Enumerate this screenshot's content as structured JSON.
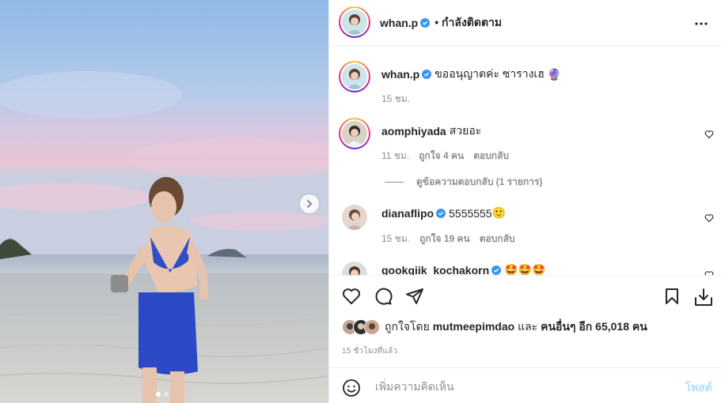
{
  "post": {
    "author": "whan.p",
    "header_status": "• กำลังติดตาม",
    "caption": "ขออนุญาตค่ะ ซารางเฮ",
    "caption_emoji": "🔮",
    "caption_time": "15 ชม."
  },
  "comments": [
    {
      "user": "aomphiyada",
      "text": "สวยอะ",
      "time": "11 ชม.",
      "likes": "ถูกใจ 4 คน",
      "reply": "ตอบกลับ",
      "view_replies": "ดูข้อความตอบกลับ (1 รายการ)"
    },
    {
      "user": "dianaflipo",
      "text": "5555555",
      "emoji": "🙂",
      "time": "15 ชม.",
      "likes": "ถูกใจ 19 คน",
      "reply": "ตอบกลับ"
    },
    {
      "user": "gookgiik_kochakorn",
      "text": "",
      "emoji": "🤩🤩🤩"
    }
  ],
  "likes": {
    "prefix": "ถูกใจโดย",
    "first_user": "mutmeepimdao",
    "and": "และ",
    "others": "คนอื่นๆ อีก 65,018 คน"
  },
  "post_time": "15 ชั่วโมงที่แล้ว",
  "add_comment": {
    "placeholder": "เพิ่มความคิดเห็น",
    "post_label": "โพสต์"
  },
  "colors": {
    "verified": "#3897f0",
    "post_disabled": "#b2dffc"
  },
  "icons": [
    "more-icon",
    "heart-icon",
    "comment-icon",
    "share-icon",
    "bookmark-icon",
    "download-icon",
    "emoji-icon",
    "chevron-right-icon",
    "verified-icon"
  ]
}
